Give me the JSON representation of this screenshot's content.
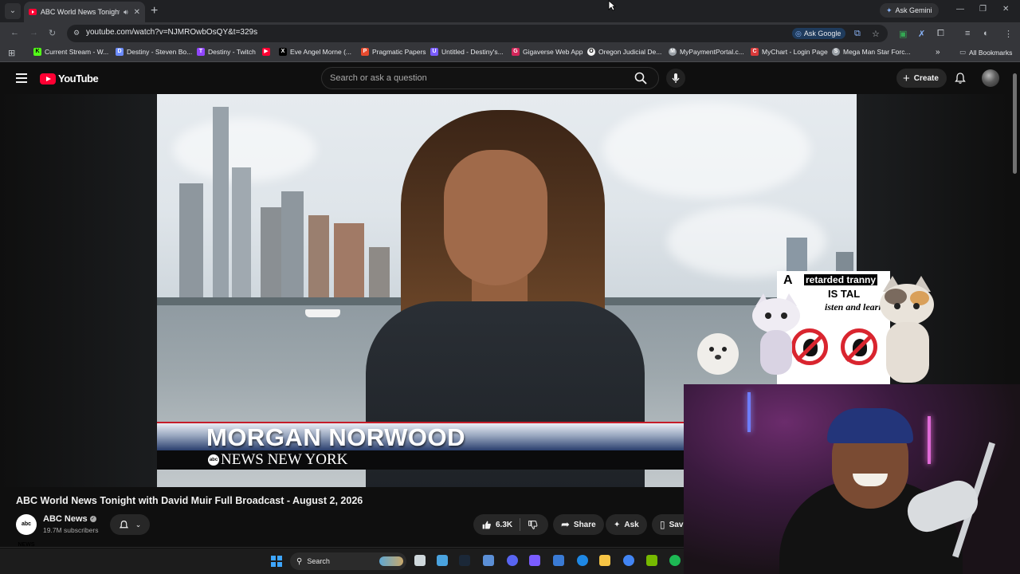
{
  "browser": {
    "tab_title": "ABC World News Tonight w",
    "new_tab_symbol": "+",
    "ask_gemini": "Ask Gemini",
    "url": "youtube.com/watch?v=NJMROwbOsQY&t=329s",
    "ask_google": "Ask Google",
    "bookmarks": [
      {
        "label": "Current Stream - W...",
        "icon": "K",
        "color": "#53fc18"
      },
      {
        "label": "Destiny - Steven Bo...",
        "icon": "D",
        "color": "#6c8cff"
      },
      {
        "label": "Destiny - Twitch",
        "icon": "T",
        "color": "#9146ff"
      },
      {
        "label": "",
        "icon": "youtube-icon",
        "color": "#ff0033"
      },
      {
        "label": "Eve Angel Morne (...",
        "icon": "X",
        "color": "#000000"
      },
      {
        "label": "Pragmatic Papers",
        "icon": "P",
        "color": "#e64a2e"
      },
      {
        "label": "Untitled - Destiny's...",
        "icon": "U",
        "color": "#7a5cff"
      },
      {
        "label": "Gigaverse Web App",
        "icon": "G",
        "color": "#d3265a"
      },
      {
        "label": "Oregon Judicial De...",
        "icon": "O",
        "color": "#f5f5f5"
      },
      {
        "label": "MyPaymentPortal.c...",
        "icon": "M",
        "color": "#9aa0a6"
      },
      {
        "label": "MyChart - Login Page",
        "icon": "C",
        "color": "#d93a3a"
      },
      {
        "label": "Mega Man Star Forc...",
        "icon": "S",
        "color": "#9aa0a6"
      }
    ],
    "more_bookmarks": "»",
    "all_bookmarks": "All Bookmarks"
  },
  "youtube": {
    "logo_text": "YouTube",
    "search_placeholder": "Search or ask a question",
    "create_label": "Create"
  },
  "video": {
    "lower_third_name": "MORGAN NORWOOD",
    "lower_third_brand": "abc",
    "lower_third_location": "NEWS  NEW YORK",
    "title": "ABC World News Tonight with David Muir Full Broadcast - August 2, 2026",
    "channel_name": "ABC News",
    "channel_avatar_text": "abc NEWS",
    "subscribers": "19.7M subscribers",
    "likes": "6.3K",
    "share_label": "Share",
    "ask_label": "Ask",
    "save_label": "Sav"
  },
  "overlay": {
    "badge": "A",
    "line1": "retarded tranny",
    "line2": "IS TAL",
    "line3": "isten and learn"
  },
  "taskbar": {
    "search_label": "Search"
  }
}
